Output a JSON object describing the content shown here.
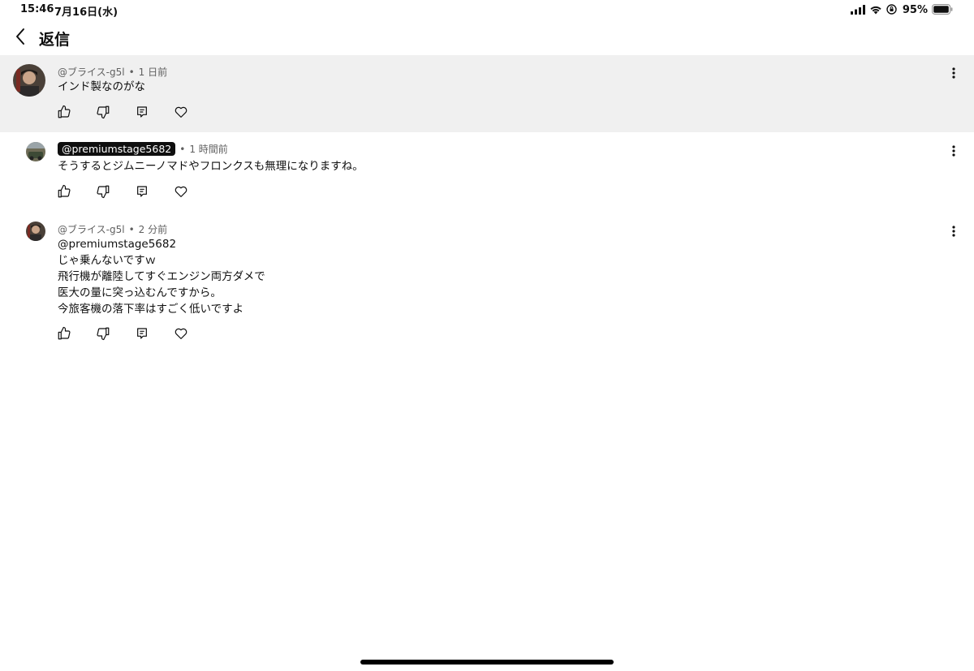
{
  "status_bar": {
    "time": "15:46",
    "date": "7月16日(水)",
    "battery_percent": "95%",
    "icons": [
      "cellular-signal-icon",
      "wifi-icon",
      "orientation-lock-icon",
      "battery-icon"
    ]
  },
  "header": {
    "title": "返信",
    "back_icon": "chevron-left-icon"
  },
  "comments": [
    {
      "author": "@ブライス-g5l",
      "time": "1 日前",
      "lines": [
        "インド製なのがな"
      ],
      "highlighted": true
    },
    {
      "author": "@premiumstage5682",
      "time": "1 時間前",
      "lines": [
        "そうするとジムニーノマドやフロンクスも無理になりますね。"
      ],
      "author_chip": true
    },
    {
      "author": "@ブライス-g5l",
      "time": "2 分前",
      "lines": [
        "@premiumstage5682",
        "じゃ乗んないですｗ",
        "飛行機が離陸してすぐエンジン両方ダメで",
        "医大の量に突っ込むんですから。",
        "今旅客機の落下率はすごく低いですよ"
      ]
    }
  ],
  "action_icons": [
    "thumbs-up-icon",
    "thumbs-down-icon",
    "reply-icon",
    "heart-icon"
  ],
  "colors": {
    "highlight_bg": "#f0f0f0",
    "meta_text": "#606060",
    "chip_bg": "#0f0f0f"
  }
}
